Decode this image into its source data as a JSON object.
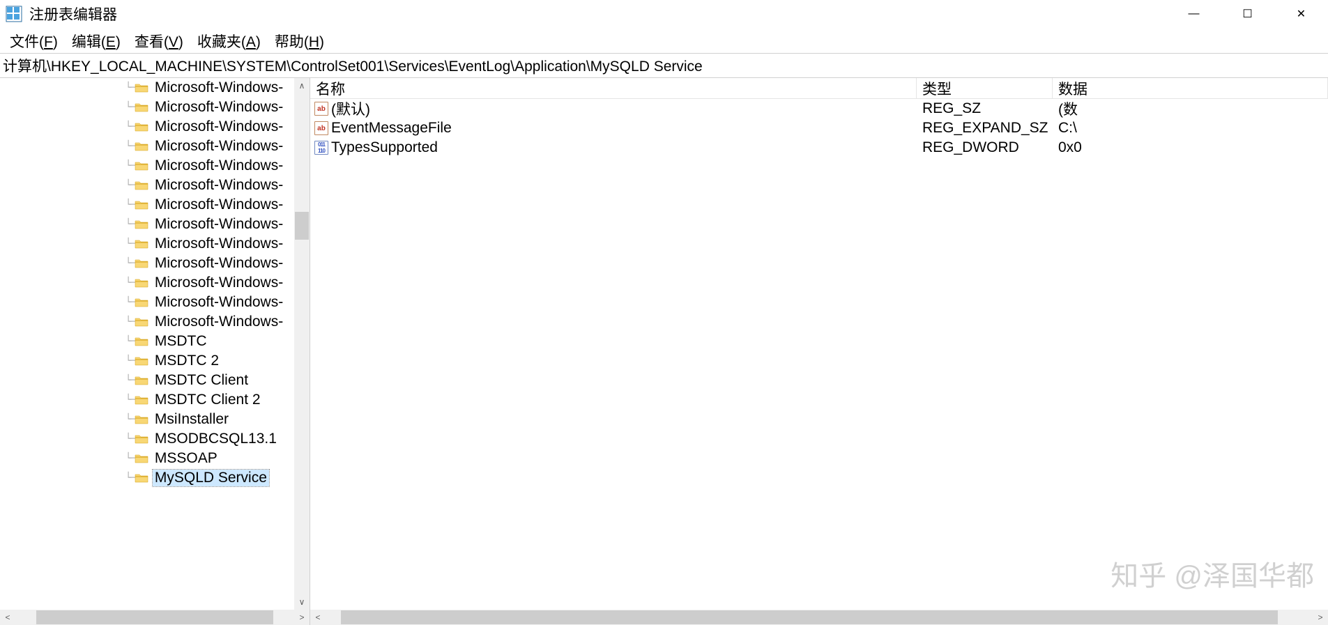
{
  "window": {
    "title": "注册表编辑器",
    "min_icon": "—",
    "max_icon": "☐",
    "close_icon": "✕"
  },
  "menu": {
    "file": "文件(F)",
    "edit": "编辑(E)",
    "view": "查看(V)",
    "fav": "收藏夹(A)",
    "help": "帮助(H)"
  },
  "address": "计算机\\HKEY_LOCAL_MACHINE\\SYSTEM\\ControlSet001\\Services\\EventLog\\Application\\MySQLD Service",
  "tree": {
    "items": [
      {
        "label": "Microsoft-Windows-",
        "selected": false
      },
      {
        "label": "Microsoft-Windows-",
        "selected": false
      },
      {
        "label": "Microsoft-Windows-",
        "selected": false
      },
      {
        "label": "Microsoft-Windows-",
        "selected": false
      },
      {
        "label": "Microsoft-Windows-",
        "selected": false
      },
      {
        "label": "Microsoft-Windows-",
        "selected": false
      },
      {
        "label": "Microsoft-Windows-",
        "selected": false
      },
      {
        "label": "Microsoft-Windows-",
        "selected": false
      },
      {
        "label": "Microsoft-Windows-",
        "selected": false
      },
      {
        "label": "Microsoft-Windows-",
        "selected": false
      },
      {
        "label": "Microsoft-Windows-",
        "selected": false
      },
      {
        "label": "Microsoft-Windows-",
        "selected": false
      },
      {
        "label": "Microsoft-Windows-",
        "selected": false
      },
      {
        "label": "MSDTC",
        "selected": false
      },
      {
        "label": "MSDTC 2",
        "selected": false
      },
      {
        "label": "MSDTC Client",
        "selected": false
      },
      {
        "label": "MSDTC Client 2",
        "selected": false
      },
      {
        "label": "MsiInstaller",
        "selected": false
      },
      {
        "label": "MSODBCSQL13.1",
        "selected": false
      },
      {
        "label": "MSSOAP",
        "selected": false
      },
      {
        "label": "MySQLD Service",
        "selected": true
      }
    ]
  },
  "list": {
    "headers": {
      "name": "名称",
      "type": "类型",
      "data": "数据"
    },
    "rows": [
      {
        "icon": "str",
        "name": "(默认)",
        "type": "REG_SZ",
        "data": "(数"
      },
      {
        "icon": "str",
        "name": "EventMessageFile",
        "type": "REG_EXPAND_SZ",
        "data": "C:\\"
      },
      {
        "icon": "bin",
        "name": "TypesSupported",
        "type": "REG_DWORD",
        "data": "0x0"
      }
    ]
  },
  "watermark": "知乎 @泽国华都"
}
